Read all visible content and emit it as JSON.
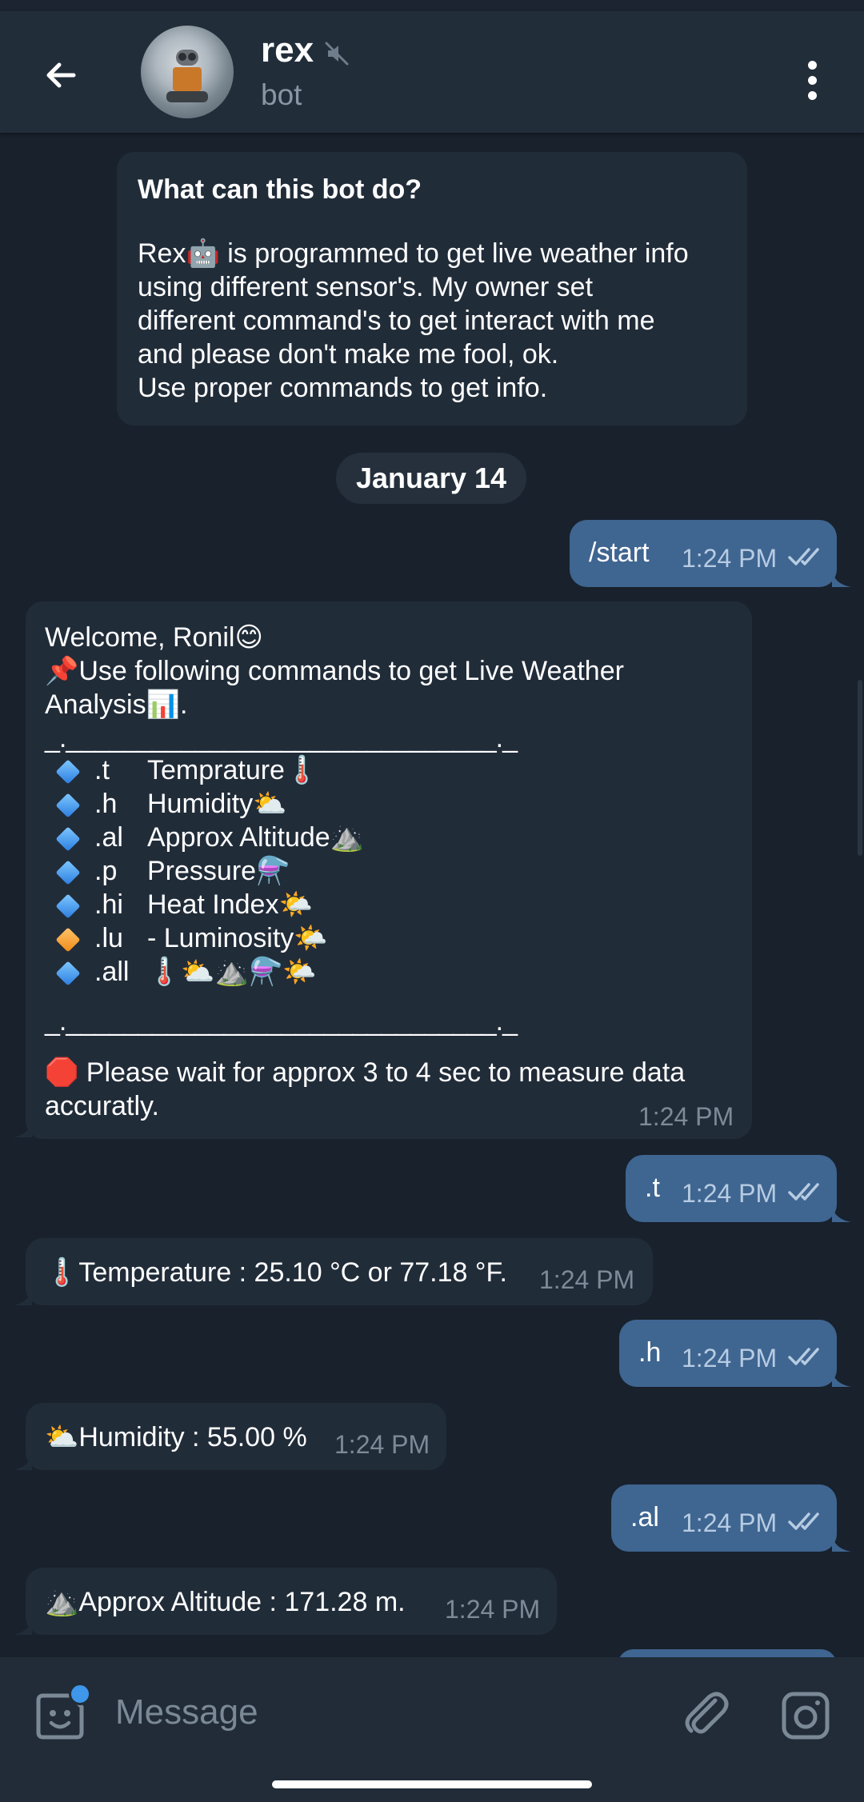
{
  "header": {
    "title": "rex",
    "subtitle": "bot",
    "icons": {
      "back": "arrow-left-icon",
      "mute": "muted-speaker-icon",
      "menu": "vertical-dots-icon"
    }
  },
  "intro": {
    "title": "What can this bot do?",
    "text": "Rex🤖 is programmed to get live weather info\nusing different sensor's. My owner set\ndifferent command's to get interact with me\nand please don't make me fool, ok.\nUse proper commands to get info."
  },
  "date_chip": "January 14",
  "messages": {
    "start": {
      "text": "/start",
      "time": "1:24 PM"
    },
    "welcome": {
      "header": "Welcome, Ronil😊\n📌Use following commands to get Live Weather\nAnalysis📊.",
      "divider": "_.______________________________._",
      "commands": [
        {
          "cmd": ".t",
          "desc": "Temprature🌡️",
          "color": "blue"
        },
        {
          "cmd": ".h",
          "desc": "Humidity⛅",
          "color": "blue"
        },
        {
          "cmd": ".al",
          "desc": "Approx Altitude⛰️",
          "color": "blue"
        },
        {
          "cmd": ".p",
          "desc": "Pressure⚗️",
          "color": "blue"
        },
        {
          "cmd": ".hi",
          "desc": "Heat Index🌤️",
          "color": "blue"
        },
        {
          "cmd": ".lu",
          "desc": "- Luminosity🌤️",
          "color": "orange"
        },
        {
          "cmd": ".all",
          "desc": "🌡️⛅⛰️⚗️🌤️",
          "color": "blue"
        }
      ],
      "divider2": "_.______________________________._",
      "footer": "🛑 Please wait for approx 3 to 4 sec to measure data\naccuratly.",
      "time": "1:24 PM"
    },
    "t": {
      "text": ".t",
      "time": "1:24 PM"
    },
    "temp": {
      "text": "🌡️Temperature : 25.10 °C or 77.18 °F.",
      "time": "1:24 PM"
    },
    "h": {
      "text": ".h",
      "time": "1:24 PM"
    },
    "hum": {
      "text": "⛅Humidity : 55.00 %",
      "time": "1:24 PM"
    },
    "al": {
      "text": ".al",
      "time": "1:24 PM"
    },
    "alt": {
      "text": "⛰️Approx Altitude : 171.28 m.",
      "time": "1:24 PM"
    }
  },
  "composer": {
    "placeholder": "Message",
    "icons": {
      "sticker": "sticker-icon",
      "attach": "paperclip-icon",
      "camera": "camera-icon"
    }
  },
  "colors": {
    "background": "#18212c",
    "header": "#222d3a",
    "incoming_bubble": "#212c39",
    "outgoing_bubble": "#3f6591",
    "accent": "#3e97eb"
  }
}
